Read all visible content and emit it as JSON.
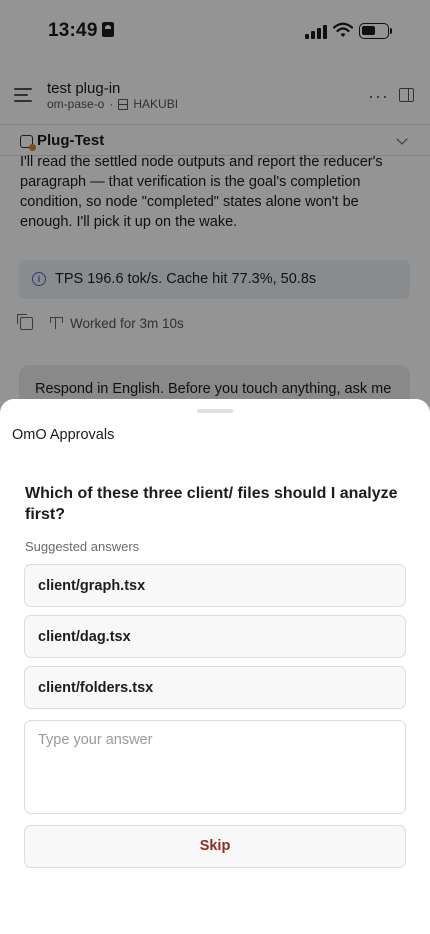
{
  "status_bar": {
    "time": "13:49"
  },
  "header": {
    "title": "test plug-in",
    "subtitle": "om-pase-o",
    "separator": "·",
    "server": "HAKUBI",
    "more_icon": "more-icon",
    "panel_icon": "panel-icon"
  },
  "project": {
    "name": "Plug-Test"
  },
  "conversation": {
    "assistant_text": "I'll read the settled node outputs and report the reducer's paragraph — that verification is the goal's completion condition, so node \"completed\" states alone won't be enough. I'll pick it up on the wake.",
    "stats": "TPS 196.6 tok/s. Cache hit 77.3%, 50.8s",
    "worked": "Worked for 3m 10s",
    "user_text": "Respond in English. Before you touch anything, ask me"
  },
  "sheet": {
    "title": "OmO Approvals",
    "question": "Which of these three client/ files should I analyze first?",
    "suggested_label": "Suggested answers",
    "options": [
      "client/graph.tsx",
      "client/dag.tsx",
      "client/folders.tsx"
    ],
    "input_placeholder": "Type your answer",
    "skip_label": "Skip"
  },
  "colors": {
    "skip_text": "#8e2c22",
    "info_accent": "#3a72c9",
    "stats_bg": "#edf1f6"
  }
}
